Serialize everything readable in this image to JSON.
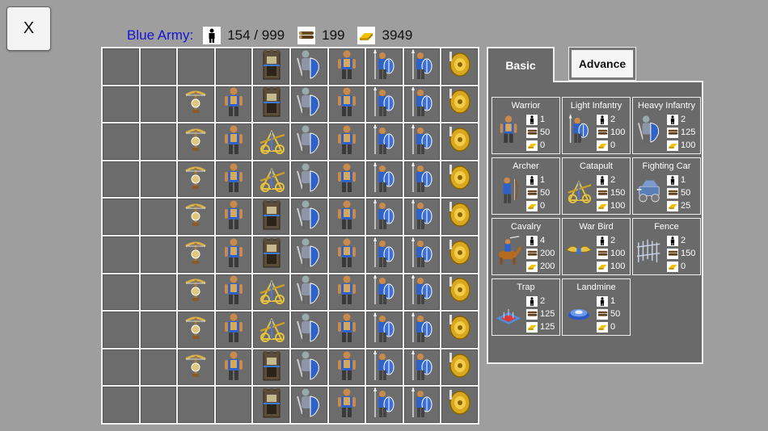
{
  "close_button": {
    "label": "X"
  },
  "army": {
    "name": "Blue Army:",
    "population": "154 / 999",
    "wood": "199",
    "gold": "3949"
  },
  "tabs": [
    {
      "label": "Basic"
    },
    {
      "label": "Advance"
    }
  ],
  "units": [
    {
      "name": "Warrior",
      "pop": "1",
      "wood": "50",
      "gold": "0",
      "icon": "warrior"
    },
    {
      "name": "Light Infantry",
      "pop": "2",
      "wood": "100",
      "gold": "0",
      "icon": "light-infantry"
    },
    {
      "name": "Heavy Infantry",
      "pop": "2",
      "wood": "125",
      "gold": "100",
      "icon": "heavy-infantry"
    },
    {
      "name": "Archer",
      "pop": "1",
      "wood": "50",
      "gold": "0",
      "icon": "archer"
    },
    {
      "name": "Catapult",
      "pop": "2",
      "wood": "150",
      "gold": "100",
      "icon": "catapult"
    },
    {
      "name": "Fighting Car",
      "pop": "1",
      "wood": "50",
      "gold": "25",
      "icon": "fighting-car"
    },
    {
      "name": "Cavalry",
      "pop": "4",
      "wood": "200",
      "gold": "200",
      "icon": "cavalry"
    },
    {
      "name": "War Bird",
      "pop": "2",
      "wood": "100",
      "gold": "100",
      "icon": "war-bird"
    },
    {
      "name": "Fence",
      "pop": "2",
      "wood": "150",
      "gold": "0",
      "icon": "fence"
    },
    {
      "name": "Trap",
      "pop": "2",
      "wood": "125",
      "gold": "125",
      "icon": "trap"
    },
    {
      "name": "Landmine",
      "pop": "1",
      "wood": "50",
      "gold": "0",
      "icon": "landmine"
    }
  ],
  "grid_rows": [
    [
      "",
      "",
      "",
      "",
      "tower",
      "heavy-infantry",
      "warrior",
      "light-infantry",
      "light-infantry",
      "shield-guard"
    ],
    [
      "",
      "",
      "crossbow",
      "warrior",
      "tower",
      "heavy-infantry",
      "warrior",
      "light-infantry",
      "light-infantry",
      "shield-guard"
    ],
    [
      "",
      "",
      "crossbow",
      "warrior",
      "catapult",
      "heavy-infantry",
      "warrior",
      "light-infantry",
      "light-infantry",
      "shield-guard"
    ],
    [
      "",
      "",
      "crossbow",
      "warrior",
      "catapult",
      "heavy-infantry",
      "warrior",
      "light-infantry",
      "light-infantry",
      "shield-guard"
    ],
    [
      "",
      "",
      "crossbow",
      "warrior",
      "tower",
      "heavy-infantry",
      "warrior",
      "light-infantry",
      "light-infantry",
      "shield-guard"
    ],
    [
      "",
      "",
      "crossbow",
      "warrior",
      "tower",
      "heavy-infantry",
      "warrior",
      "light-infantry",
      "light-infantry",
      "shield-guard"
    ],
    [
      "",
      "",
      "crossbow",
      "warrior",
      "catapult",
      "heavy-infantry",
      "warrior",
      "light-infantry",
      "light-infantry",
      "shield-guard"
    ],
    [
      "",
      "",
      "crossbow",
      "warrior",
      "catapult",
      "heavy-infantry",
      "warrior",
      "light-infantry",
      "light-infantry",
      "shield-guard"
    ],
    [
      "",
      "",
      "crossbow",
      "warrior",
      "tower",
      "heavy-infantry",
      "warrior",
      "light-infantry",
      "light-infantry",
      "shield-guard"
    ],
    [
      "",
      "",
      "",
      "",
      "tower",
      "heavy-infantry",
      "warrior",
      "light-infantry",
      "light-infantry",
      "shield-guard"
    ]
  ],
  "colors": {
    "army_name": "#1414d8",
    "panel_bg": "#6a6a6a",
    "cell_bg": "#6c6c6c",
    "gold": "#e8b400",
    "wood": "#6b4a22"
  }
}
